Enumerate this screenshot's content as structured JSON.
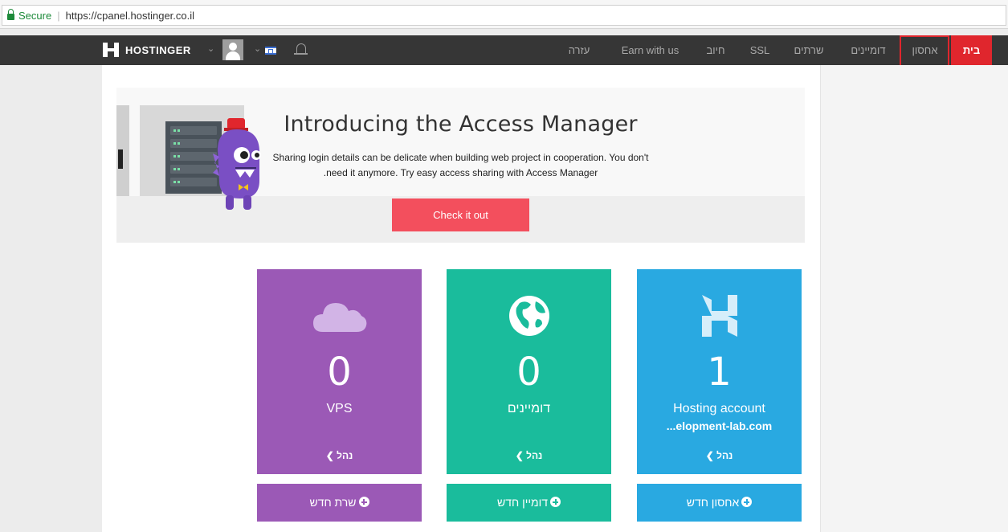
{
  "browser": {
    "secure_label": "Secure",
    "separator": "|",
    "url": "https://cpanel.hostinger.co.il"
  },
  "nav": {
    "brand": "HOSTINGER",
    "items": [
      {
        "label": "בית",
        "active": true
      },
      {
        "label": "אחסון",
        "active": false
      },
      {
        "label": "דומיינים",
        "active": false
      },
      {
        "label": "שרתים",
        "active": false
      },
      {
        "label": "SSL",
        "active": false
      },
      {
        "label": "חיוב",
        "active": false
      },
      {
        "label": "Earn with us",
        "active": false
      },
      {
        "label": "עזרה",
        "active": false
      }
    ],
    "icons": [
      "avatar",
      "israel-flag-icon",
      "bell-icon",
      "chevron-down-icon"
    ]
  },
  "banner": {
    "title": "Introducing the Access Manager",
    "text_line1": "Sharing login details can be delicate when building web project in cooperation. You don't",
    "text_line2": ".need it anymore. Try easy access sharing with Access Manager",
    "cta": "Check it out"
  },
  "cards": [
    {
      "id": "hosting",
      "icon": "hostinger-logo-icon",
      "count": "1",
      "label": "Hosting account",
      "sub": "...elopment-lab.com",
      "manage": "נהל",
      "add": "אחסון חדש",
      "color": "#29a9e1"
    },
    {
      "id": "domains",
      "icon": "globe-icon",
      "count": "0",
      "label": "דומיינים",
      "sub": "",
      "manage": "נהל",
      "add": "דומיין חדש",
      "color": "#1abc9c"
    },
    {
      "id": "vps",
      "icon": "cloud-icon",
      "count": "0",
      "label": "VPS",
      "sub": "",
      "manage": "נהל",
      "add": "שרת חדש",
      "color": "#9b59b6"
    }
  ],
  "colors": {
    "accent": "#e0262d",
    "nav_bg": "#363636",
    "cta": "#f34f5d"
  }
}
